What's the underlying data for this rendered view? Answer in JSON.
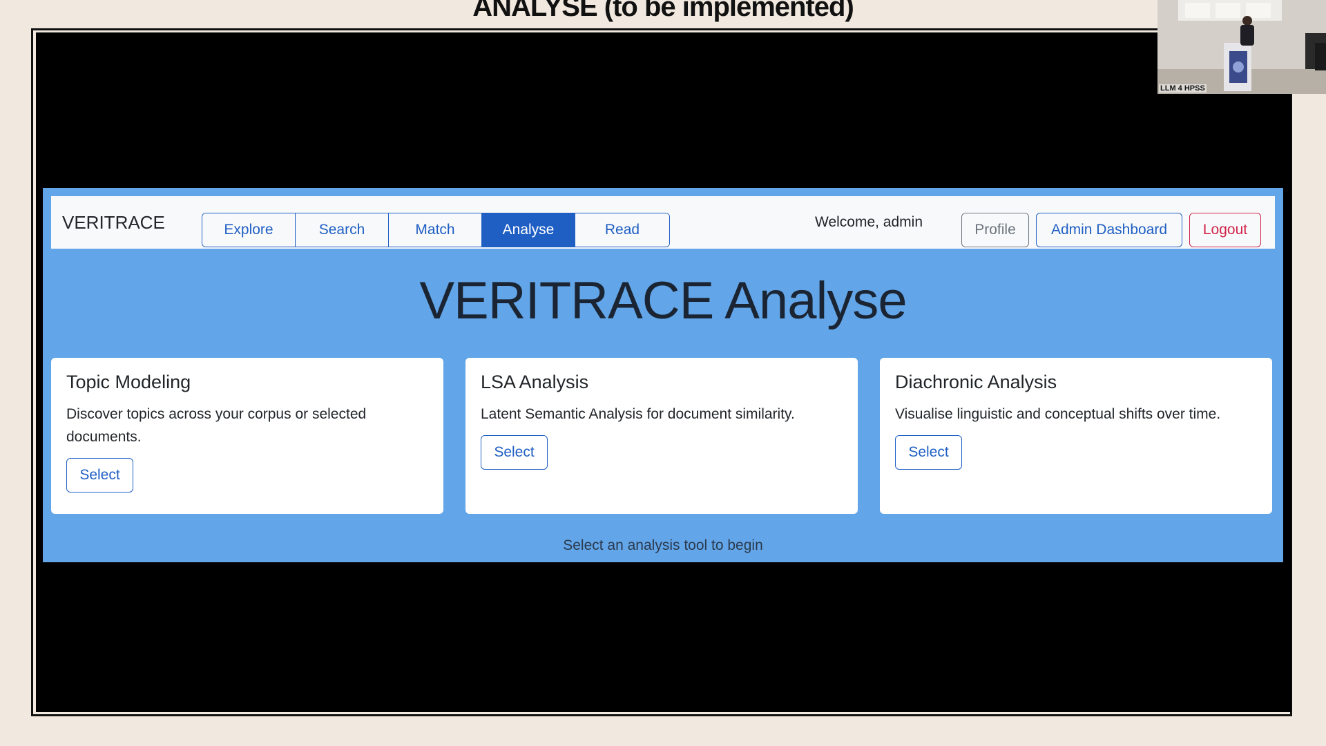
{
  "slide": {
    "title": "ANALYSE (to be implemented)"
  },
  "webcam": {
    "label": "LLM 4 HPSS"
  },
  "app": {
    "brand": "VERITRACE",
    "tabs": [
      {
        "label": "Explore",
        "active": false
      },
      {
        "label": "Search",
        "active": false
      },
      {
        "label": "Match",
        "active": false
      },
      {
        "label": "Analyse",
        "active": true
      },
      {
        "label": "Read",
        "active": false
      }
    ],
    "welcome": "Welcome, admin",
    "profile_label": "Profile",
    "admin_label": "Admin Dashboard",
    "logout_label": "Logout",
    "heading": "VERITRACE Analyse",
    "cards": [
      {
        "title": "Topic Modeling",
        "text": "Discover topics across your corpus or selected documents.",
        "button": "Select"
      },
      {
        "title": "LSA Analysis",
        "text": "Latent Semantic Analysis for document similarity.",
        "button": "Select"
      },
      {
        "title": "Diachronic Analysis",
        "text": "Visualise linguistic and conceptual shifts over time.",
        "button": "Select"
      }
    ],
    "footer_hint": "Select an analysis tool to begin"
  },
  "colors": {
    "primary": "#1f5fc4",
    "app_background": "#62a5e8",
    "danger": "#d0244a",
    "secondary": "#6c757d",
    "slide_background": "#f1e9df"
  }
}
